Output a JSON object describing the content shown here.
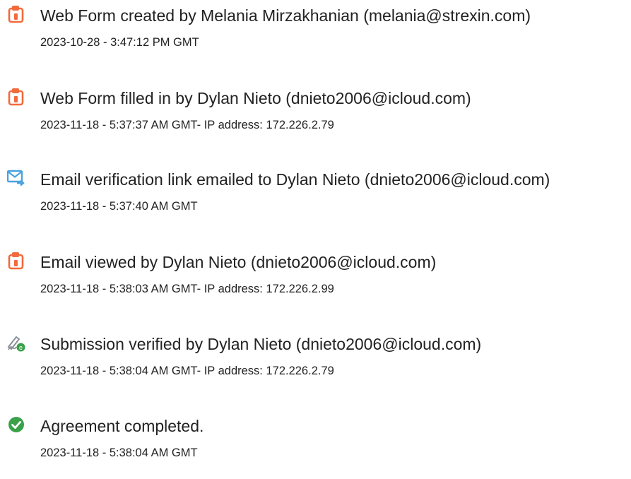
{
  "audit_trail": {
    "events": [
      {
        "icon": "document-icon",
        "title": "Web Form created by Melania Mirzakhanian (melania@strexin.com)",
        "meta": "2023-10-28 - 3:47:12 PM GMT"
      },
      {
        "icon": "document-icon",
        "title": "Web Form filled in by Dylan Nieto (dnieto2006@icloud.com)",
        "meta": "2023-11-18 - 5:37:37 AM GMT- IP address: 172.226.2.79"
      },
      {
        "icon": "email-send-icon",
        "title": "Email verification link emailed to Dylan Nieto (dnieto2006@icloud.com)",
        "meta": "2023-11-18 - 5:37:40 AM GMT"
      },
      {
        "icon": "document-icon",
        "title": "Email viewed by Dylan Nieto (dnieto2006@icloud.com)",
        "meta": "2023-11-18 - 5:38:03 AM GMT- IP address: 172.226.2.99"
      },
      {
        "icon": "signature-verified-icon",
        "title": "Submission verified by Dylan Nieto (dnieto2006@icloud.com)",
        "meta": "2023-11-18 - 5:38:04 AM GMT- IP address: 172.226.2.79"
      },
      {
        "icon": "check-circle-icon",
        "title": "Agreement completed.",
        "meta": "2023-11-18 - 5:38:04 AM GMT"
      }
    ],
    "colors": {
      "document_orange": "#f26a3d",
      "email_blue": "#4aa3df",
      "signature_gray": "#8a8f99",
      "check_green": "#3aa14a"
    }
  }
}
